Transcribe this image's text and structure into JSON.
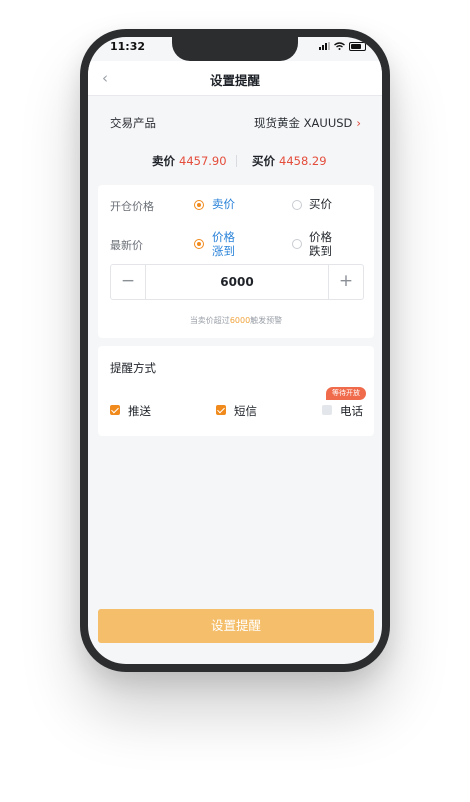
{
  "status_bar": {
    "time": "11:32"
  },
  "navbar": {
    "title": "设置提醒",
    "back_icon": "chevron-left-icon"
  },
  "product": {
    "label": "交易产品",
    "value": "现货黄金 XAUUSD",
    "chevron": "›"
  },
  "quote": {
    "sell_label": "卖价",
    "sell_value": "4457.90",
    "buy_label": "买价",
    "buy_value": "4458.29"
  },
  "open_price": {
    "label": "开仓价格",
    "options": [
      {
        "label": "卖价",
        "selected": true
      },
      {
        "label": "买价",
        "selected": false
      }
    ]
  },
  "latest_price": {
    "label": "最新价",
    "options": [
      {
        "label_line1": "价格",
        "label_line2": "涨到",
        "selected": true
      },
      {
        "label_line1": "价格",
        "label_line2": "跌到",
        "selected": false
      }
    ]
  },
  "stepper": {
    "value": "6000",
    "minus": "−",
    "plus": "+"
  },
  "hint": {
    "prefix": "当卖价超过",
    "value": "6000",
    "suffix": "触发预警"
  },
  "alert_method": {
    "title": "提醒方式",
    "options": [
      {
        "label": "推送",
        "checked": true
      },
      {
        "label": "短信",
        "checked": true
      },
      {
        "label": "电话",
        "checked": false
      }
    ],
    "badge": "等待开放"
  },
  "submit": {
    "label": "设置提醒"
  },
  "colors": {
    "accent_orange": "#f08a1c",
    "selected_blue": "#2a83d9",
    "price_red": "#e44d3b",
    "submit_bg": "#f4be6b",
    "badge_bg": "#ef6b4c"
  }
}
